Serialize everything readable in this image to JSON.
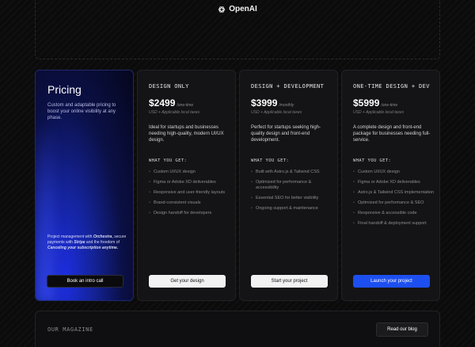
{
  "header": {
    "brand": "OpenAI"
  },
  "intro": {
    "title": "Pricing",
    "description": "Custom and adaptable pricing to boost your online visibility at any phase.",
    "note_prefix": "Project management with ",
    "note_orchestra": "Orchestra",
    "note_mid": ", secure payments with ",
    "note_stripe": "Stripe",
    "note_mid2": " and the freedom of ",
    "note_cancel": "Canceling your subscription anytime.",
    "button": "Book an intro call"
  },
  "plans": [
    {
      "name": "DESIGN ONLY",
      "price": "$2499",
      "period": "/one-time",
      "tax": "USD + Applicable local taxes",
      "description": "Ideal for startups and businesses needing high-quality, modern UI/UX design.",
      "features_title": "WHAT YOU GET:",
      "features": [
        "Custom UI/UX design",
        "Figma or Adobe XD deliverables",
        "Responsive and user-friendly layouts",
        "Brand-consistent visuals",
        "Design handoff for developers"
      ],
      "cta": "Get your design"
    },
    {
      "name": "DESIGN + DEVELOPMENT",
      "price": "$3999",
      "period": "/monthly",
      "tax": "USD + Applicable local taxes",
      "description": "Perfect for startups seeking high-quality design and front-end development.",
      "features_title": "WHAT YOU GET:",
      "features": [
        "Built with Astro.js & Tailwind CSS",
        "Optimized for performance & accessibility",
        "Essential SEO for better visibility",
        "Ongoing support & maintenance"
      ],
      "cta": "Start your project"
    },
    {
      "name": "ONE-TIME DESIGN + DEV",
      "price": "$5999",
      "period": "/one-time",
      "tax": "USD + Applicable local taxes",
      "description": "A complete design and front-end package for businesses needing full-service.",
      "features_title": "WHAT YOU GET:",
      "features": [
        "Custom UI/UX design",
        "Figma or Adobe XD deliverables",
        "Astro.js & Tailwind CSS implementation",
        "Optimized for performance & SEO",
        "Responsive & accessible code",
        "Final handoff & deployment support"
      ],
      "cta": "Launch your project"
    }
  ],
  "magazine": {
    "label": "OUR MAGAZINE",
    "button": "Read our blog"
  },
  "colors": {
    "accent": "#1d4ff0",
    "background": "#0b0b0c",
    "card": "#141416"
  }
}
